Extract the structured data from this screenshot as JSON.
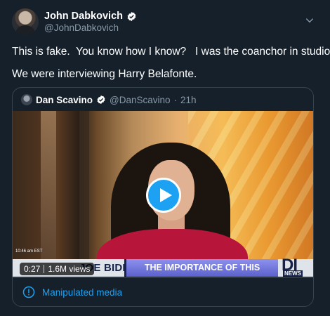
{
  "tweet": {
    "author_name": "John Dabkovich",
    "author_handle": "@JohnDabkovich",
    "text_line1": "This is fake.  You know how I know?   I was the coanchor in studio.",
    "text_line2": "We were interviewing Harry Belafonte."
  },
  "quoted": {
    "author_name": "Dan Scavino",
    "author_handle": "@DanScavino",
    "separator": "·",
    "time": "21h",
    "video": {
      "duration": "0:27",
      "views": "1.6M views",
      "ticker_small": "10:46 am EST",
      "ticker_name": "JOE BIDEN",
      "ticker_headline": "THE IMPORTANCE OF THIS ELECTION",
      "logo_main": "DI",
      "logo_sub": "NEWS"
    },
    "footer_label": "Manipulated media"
  },
  "colors": {
    "background": "#15202b",
    "accent": "#1da1f2",
    "secondary_text": "#8899a6",
    "border": "#38444d"
  },
  "icons": [
    "verified-badge-icon",
    "chevron-down-icon",
    "play-icon",
    "info-icon"
  ]
}
